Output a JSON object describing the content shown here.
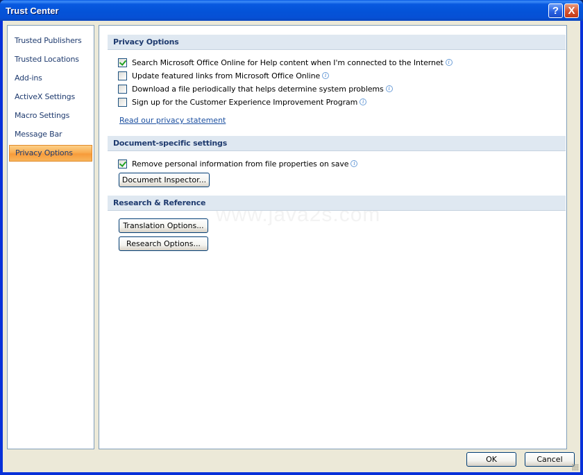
{
  "window": {
    "title": "Trust Center",
    "help_button": "?",
    "close_button": "X"
  },
  "sidebar": {
    "items": [
      {
        "label": "Trusted Publishers",
        "selected": false
      },
      {
        "label": "Trusted Locations",
        "selected": false
      },
      {
        "label": "Add-ins",
        "selected": false
      },
      {
        "label": "ActiveX Settings",
        "selected": false
      },
      {
        "label": "Macro Settings",
        "selected": false
      },
      {
        "label": "Message Bar",
        "selected": false
      },
      {
        "label": "Privacy Options",
        "selected": true
      }
    ]
  },
  "privacy_options": {
    "header": "Privacy Options",
    "checkboxes": [
      {
        "label": "Search Microsoft Office Online for Help content when I'm connected to the Internet",
        "checked": true
      },
      {
        "label": "Update featured links from Microsoft Office Online",
        "checked": false
      },
      {
        "label": "Download a file periodically that helps determine system problems",
        "checked": false
      },
      {
        "label": "Sign up for the Customer Experience Improvement Program",
        "checked": false
      }
    ],
    "privacy_link": "Read our privacy statement"
  },
  "document_settings": {
    "header": "Document-specific settings",
    "checkbox": {
      "label": "Remove personal information from file properties on save",
      "checked": true
    },
    "inspector_button": "Document Inspector..."
  },
  "research_reference": {
    "header": "Research & Reference",
    "translation_button": "Translation Options...",
    "research_button": "Research Options..."
  },
  "watermark": "www.java2s.com",
  "footer": {
    "ok_label": "OK",
    "cancel_label": "Cancel"
  },
  "icons": {
    "info": "i"
  }
}
